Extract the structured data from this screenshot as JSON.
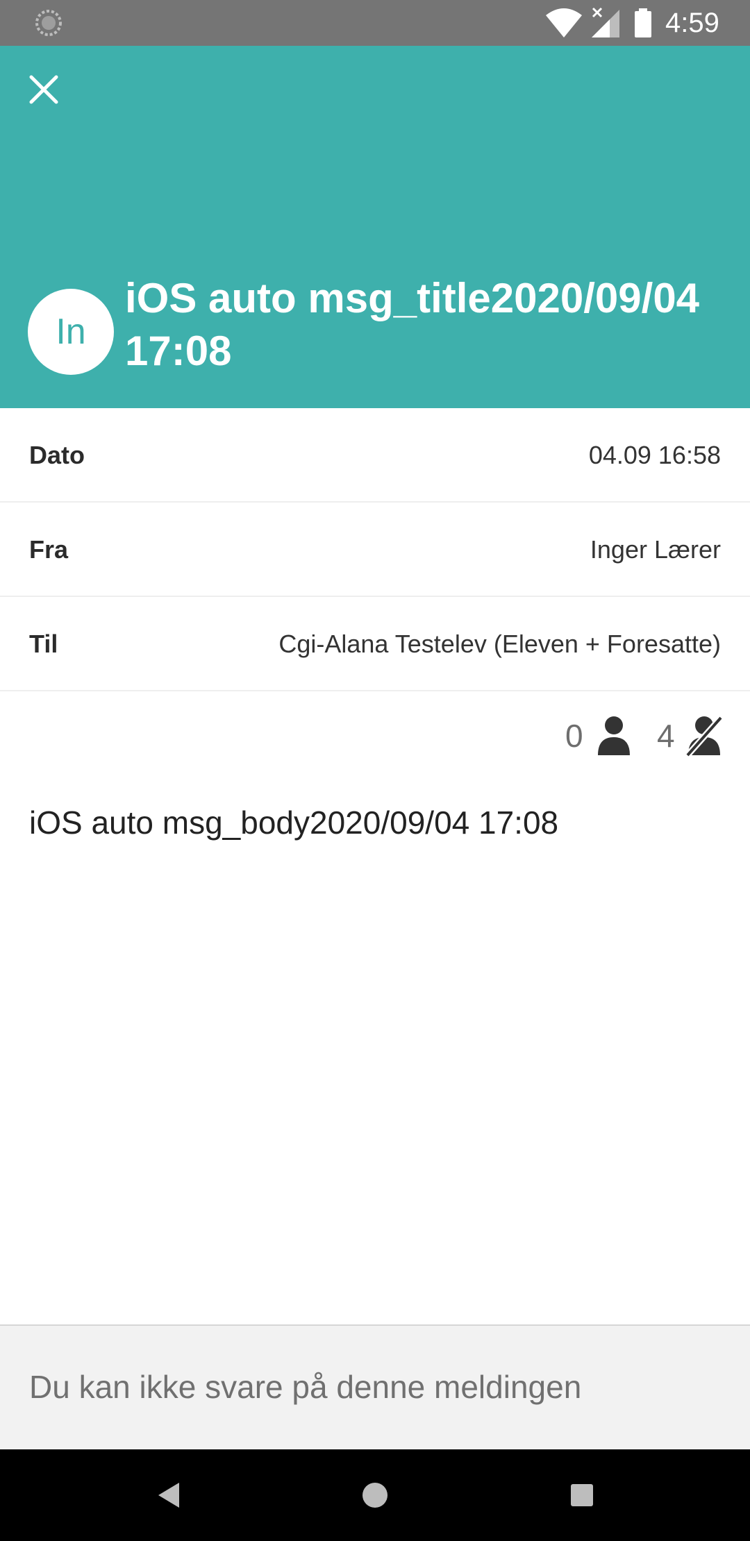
{
  "status_bar": {
    "time": "4:59",
    "icons": [
      "sync-icon",
      "wifi-icon",
      "signal-icon",
      "battery-icon"
    ]
  },
  "header": {
    "close_icon": "close-icon",
    "avatar_initials": "In",
    "title": "iOS auto msg_title2020/09/04 17:08",
    "background_color": "#3eb0ac"
  },
  "details": {
    "date": {
      "label": "Dato",
      "value": "04.09 16:58"
    },
    "from": {
      "label": "Fra",
      "value": "Inger Lærer"
    },
    "to": {
      "label": "Til",
      "value": "Cgi-Alana Testelev (Eleven + Foresatte)"
    }
  },
  "read_status": {
    "read_count": "0",
    "unread_count": "4",
    "read_icon": "person-icon",
    "unread_icon": "person-off-icon"
  },
  "message": {
    "body": "iOS auto msg_body2020/09/04 17:08"
  },
  "footer": {
    "notice": "Du kan ikke svare på denne meldingen"
  },
  "nav_bar": {
    "icons": [
      "back-icon",
      "home-icon",
      "recents-icon"
    ]
  }
}
